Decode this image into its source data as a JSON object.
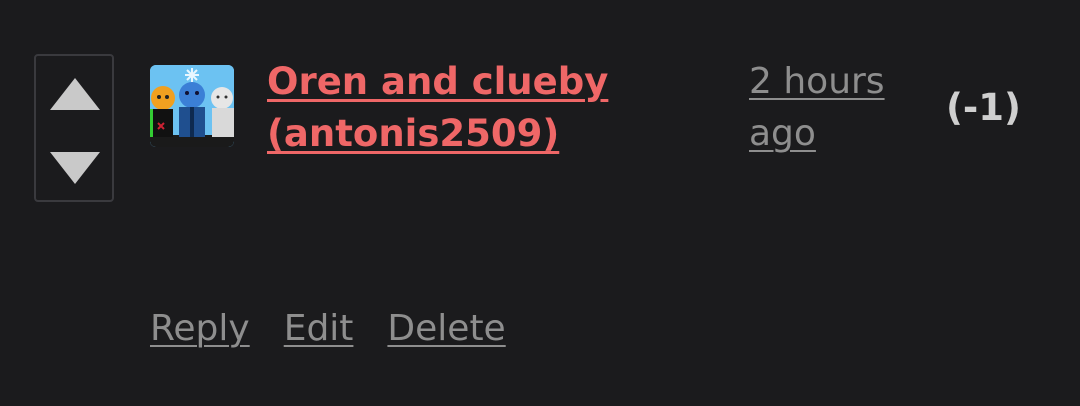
{
  "comment": {
    "author": "Oren and clueby (antonis2509)",
    "time": "2 hours ago",
    "score": "(-1)"
  },
  "actions": {
    "reply": "Reply",
    "edit": "Edit",
    "delete": "Delete"
  },
  "colors": {
    "background": "#1b1b1d",
    "author_link": "#ef6767",
    "muted_link": "#8e8e8e",
    "score": "#cfcfcf",
    "vote_arrow": "#c9c9c9"
  },
  "icons": {
    "upvote": "triangle-up",
    "downvote": "triangle-down"
  }
}
